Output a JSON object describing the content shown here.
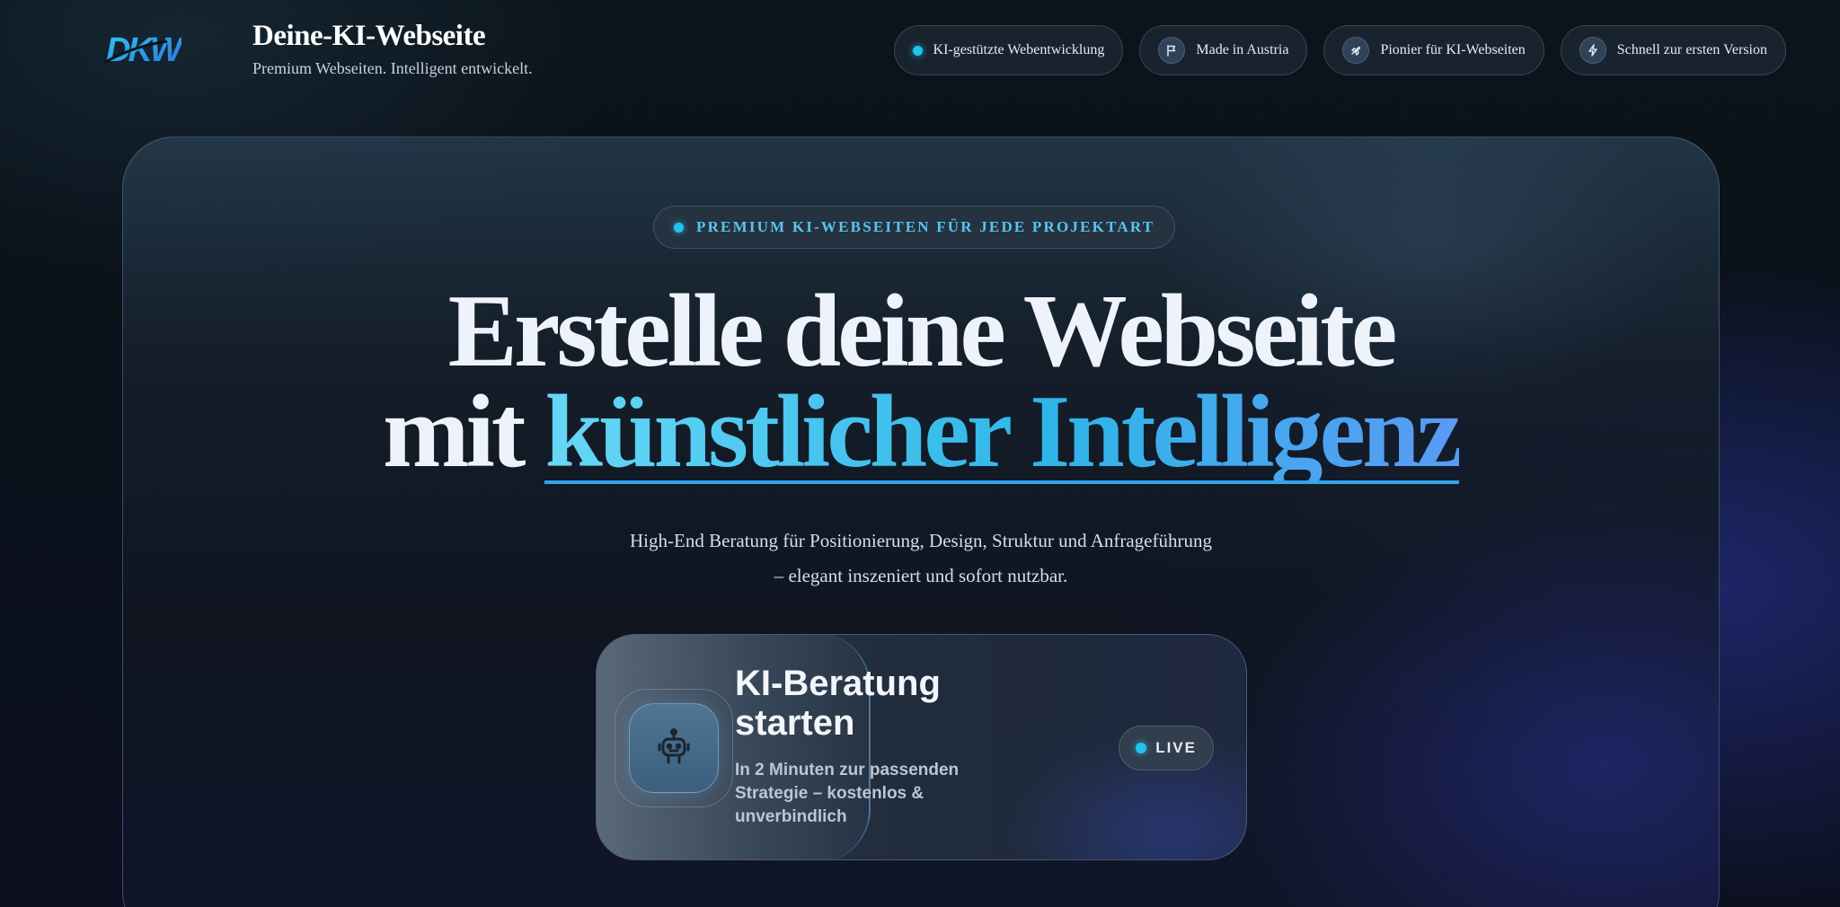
{
  "header": {
    "logo_text": "DKW",
    "title": "Deine-KI-Webseite",
    "subtitle": "Premium Webseiten. Intelligent entwickelt."
  },
  "pills": [
    {
      "label": "KI-gestützte Webentwicklung",
      "icon": "status-dot"
    },
    {
      "label": "Made in Austria",
      "icon": "flag-icon"
    },
    {
      "label": "Pionier für KI-Webseiten",
      "icon": "rocket-icon"
    },
    {
      "label": "Schnell zur ersten Version",
      "icon": "lightning-icon"
    }
  ],
  "hero": {
    "badge": "PREMIUM KI-WEBSEITEN FÜR JEDE PROJEKTART",
    "headline_line1": "Erstelle deine Webseite",
    "headline_line2_prefix": "mit ",
    "headline_line2_accent": "künstlicher Intelligenz",
    "subline_line1": "High-End Beratung für Positionierung, Design, Struktur und Anfrageführung",
    "subline_line2": "– elegant inszeniert und sofort nutzbar."
  },
  "cta": {
    "title": "KI-Beratung starten",
    "description": "In 2 Minuten zur passenden Strategie – kostenlos & unverbindlich",
    "live_label": "LIVE",
    "icon": "robot-icon"
  },
  "colors": {
    "accent": "#22c3ea",
    "accent_text": "#56c6ee",
    "gradient_start": "#67d7f7",
    "gradient_end": "#5a9af4",
    "background": "#0a111a"
  }
}
